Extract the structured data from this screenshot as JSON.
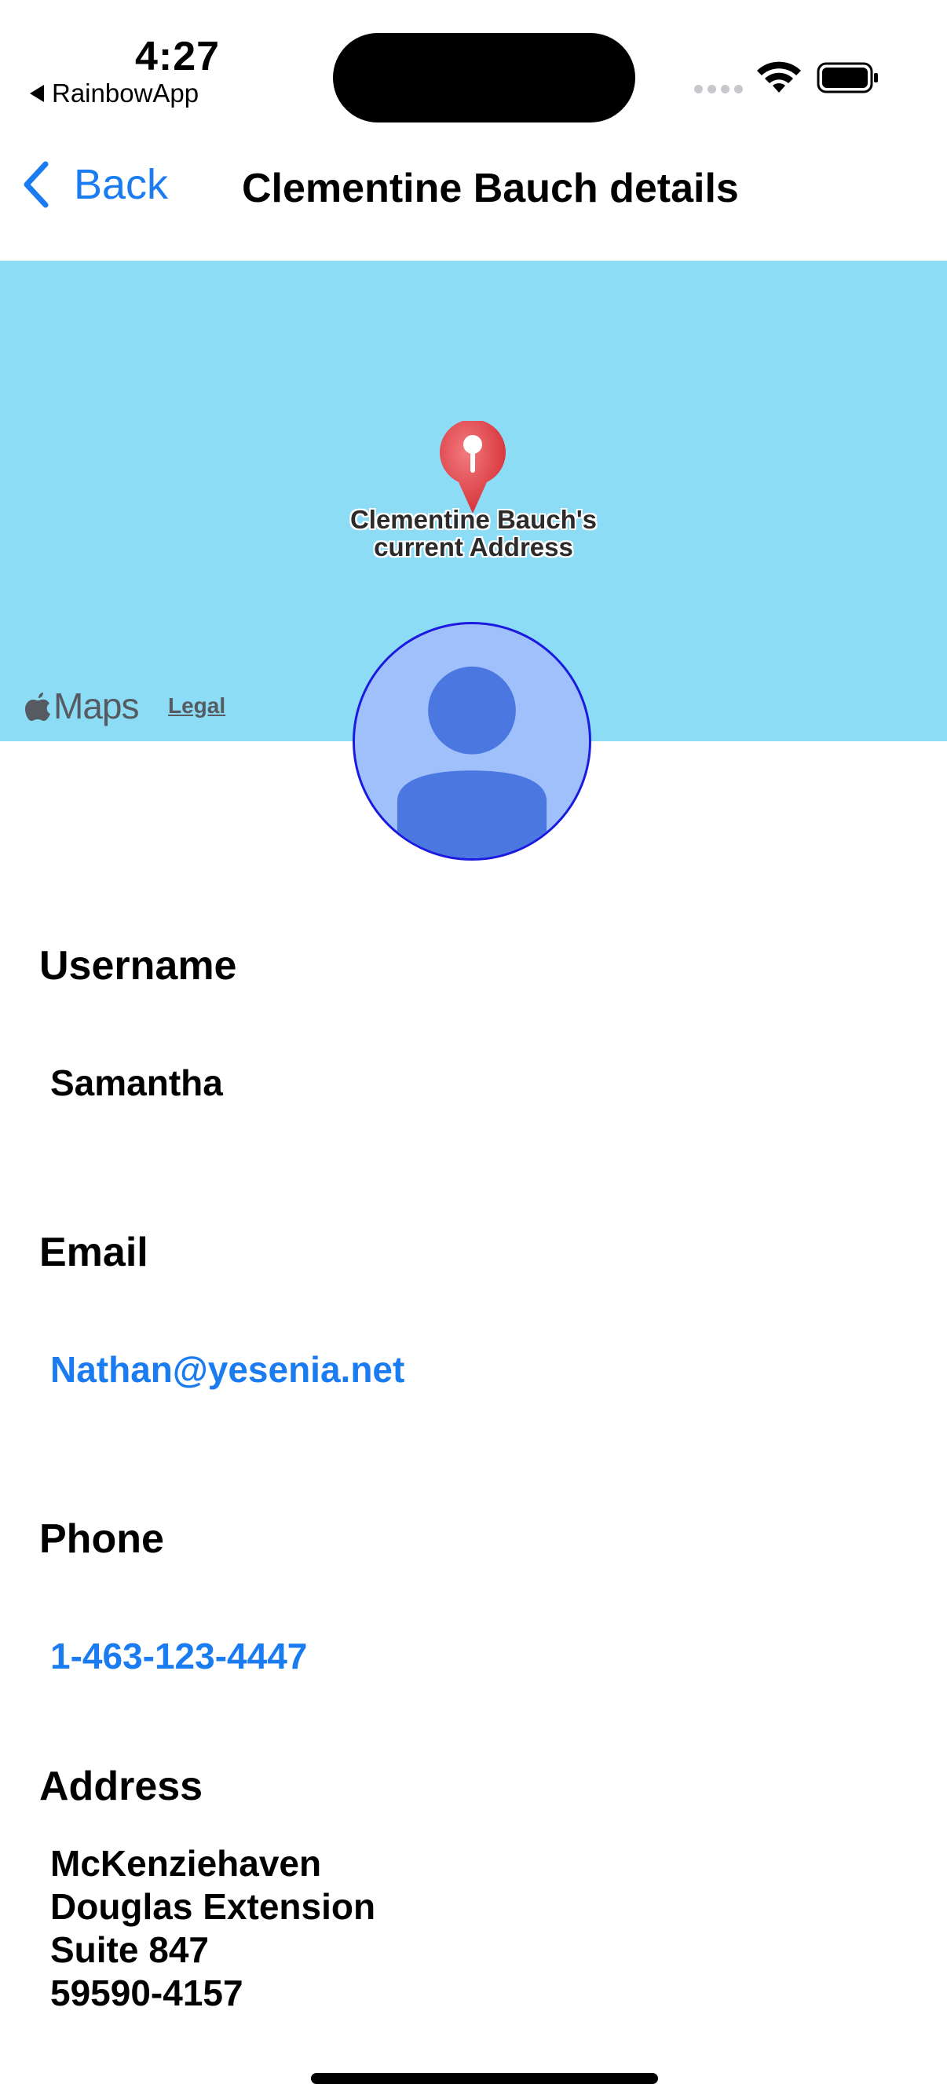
{
  "status_bar": {
    "time": "4:27",
    "back_app_label": "RainbowApp"
  },
  "nav": {
    "back_label": "Back",
    "title": "Clementine Bauch details"
  },
  "map": {
    "pin_label_line1": "Clementine Bauch's",
    "pin_label_line2": "current Address",
    "maps_brand": "Maps",
    "legal_label": "Legal"
  },
  "details": {
    "username_label": "Username",
    "username_value": "Samantha",
    "email_label": "Email",
    "email_value": "Nathan@yesenia.net",
    "phone_label": "Phone",
    "phone_value": "1-463-123-4447",
    "address_label": "Address",
    "address_lines": [
      "McKenziehaven",
      "Douglas Extension",
      "Suite 847",
      "59590-4157"
    ]
  },
  "colors": {
    "accent": "#1a7cf0",
    "map_water": "#8ddcf6",
    "avatar_bg": "#a0c0fc",
    "avatar_figure": "#4a78e0",
    "avatar_border": "#1b1be0",
    "pin_red": "#e8444a"
  },
  "icons": {
    "back": "chevron-left-icon",
    "wifi": "wifi-icon",
    "battery": "battery-icon",
    "pin": "map-pin-icon",
    "apple": "apple-logo-icon",
    "avatar": "person-icon"
  }
}
